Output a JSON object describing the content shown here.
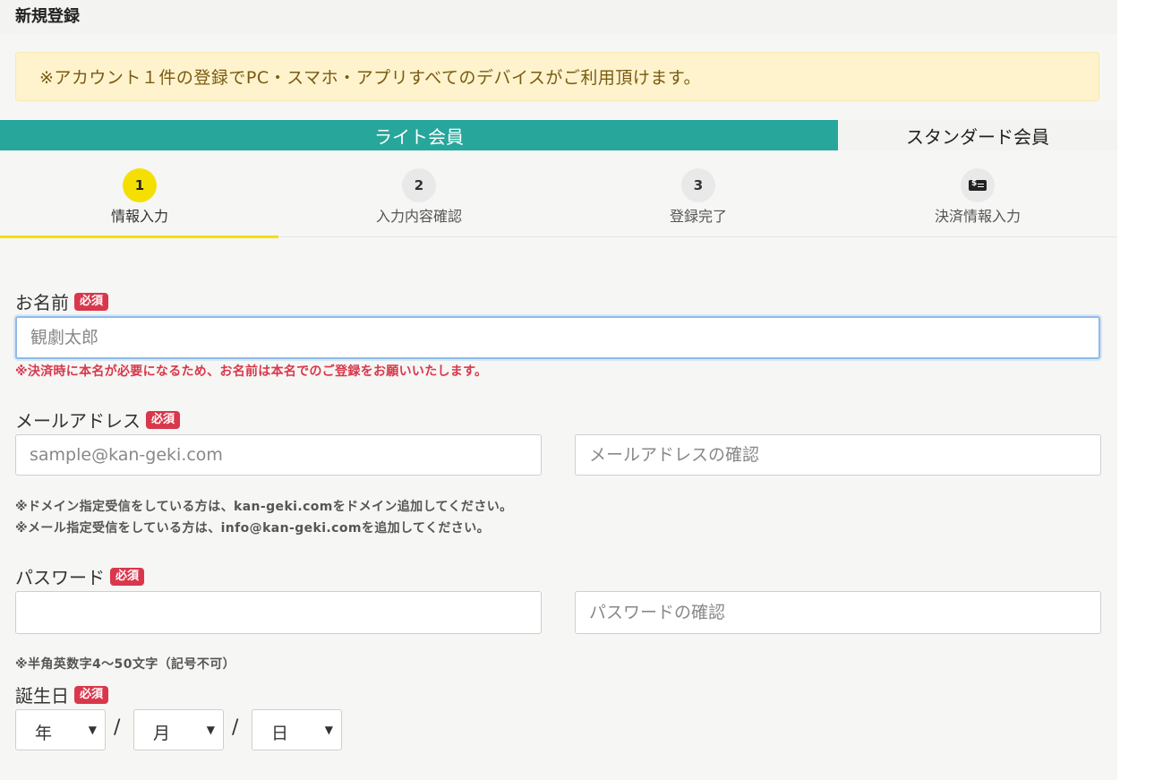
{
  "header": {
    "title": "新規登録"
  },
  "notice": {
    "text": "※アカウント１件の登録でPC・スマホ・アプリすべてのデバイスがご利用頂けます。"
  },
  "plan_tabs": [
    {
      "label": "ライト会員",
      "active": true
    },
    {
      "label": "スタンダード会員",
      "active": false
    }
  ],
  "steps": [
    {
      "number": "1",
      "label": "情報入力",
      "active": true
    },
    {
      "number": "2",
      "label": "入力内容確認",
      "active": false
    },
    {
      "number": "3",
      "label": "登録完了",
      "active": false
    },
    {
      "icon": "payment-card-icon",
      "label": "決済情報入力",
      "active": false
    }
  ],
  "required_badge": "必須",
  "form": {
    "name": {
      "label": "お名前",
      "placeholder": "観劇太郎",
      "value": "",
      "note": "※決済時に本名が必要になるため、お名前は本名でのご登録をお願いいたします。"
    },
    "email": {
      "label": "メールアドレス",
      "placeholder": "sample@kan-geki.com",
      "confirm_placeholder": "メールアドレスの確認",
      "notes": [
        "※ドメイン指定受信をしている方は、kan-geki.comをドメイン追加してください。",
        "※メール指定受信をしている方は、info@kan-geki.comを追加してください。"
      ]
    },
    "password": {
      "label": "パスワード",
      "placeholder": "",
      "confirm_placeholder": "パスワードの確認",
      "note": "※半角英数字4～50文字（記号不可）"
    },
    "birthday": {
      "label": "誕生日",
      "year": "年",
      "month": "月",
      "day": "日",
      "separator": "/"
    }
  },
  "colors": {
    "accent_teal": "#27a79b",
    "step_active": "#f5df00",
    "required_red": "#d9374b",
    "notice_bg": "#fff3cd"
  }
}
